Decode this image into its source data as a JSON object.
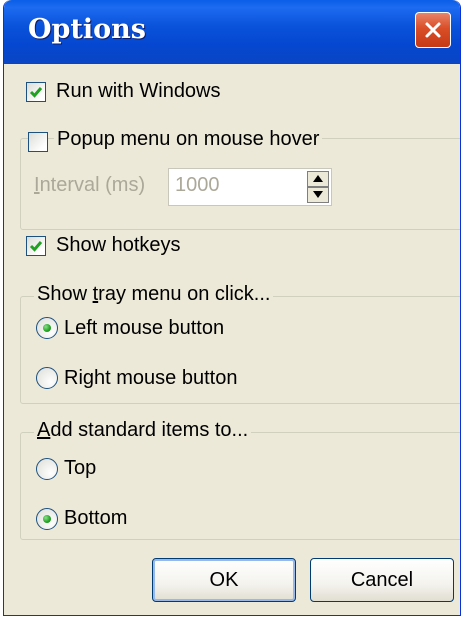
{
  "window": {
    "title": "Options",
    "close_icon": "close-icon"
  },
  "run_with_windows": {
    "label": "Run with Windows",
    "checked": true
  },
  "popup_hover": {
    "label": "Popup menu on mouse hover",
    "checked": false
  },
  "interval": {
    "label_prefix": "I",
    "label_rest": "nterval (ms)",
    "value": "1000"
  },
  "show_hotkeys": {
    "label": "Show hotkeys",
    "checked": true
  },
  "tray_group": {
    "legend_prefix": "Show ",
    "legend_underline": "t",
    "legend_rest": "ray menu on click...",
    "options": [
      {
        "label": "Left mouse button",
        "selected": true
      },
      {
        "label": "Right mouse button",
        "selected": false
      }
    ]
  },
  "std_group": {
    "legend_underline": "A",
    "legend_rest": "dd standard items to...",
    "options": [
      {
        "label": "Top",
        "selected": false
      },
      {
        "label": "Bottom",
        "selected": true
      }
    ]
  },
  "buttons": {
    "ok": "OK",
    "cancel": "Cancel"
  },
  "colors": {
    "title_bar": "#0A53DB",
    "close": "#D94E27",
    "dialog_bg": "#ECE9D8",
    "radio_dot": "#21A121",
    "check": "#21A121"
  }
}
